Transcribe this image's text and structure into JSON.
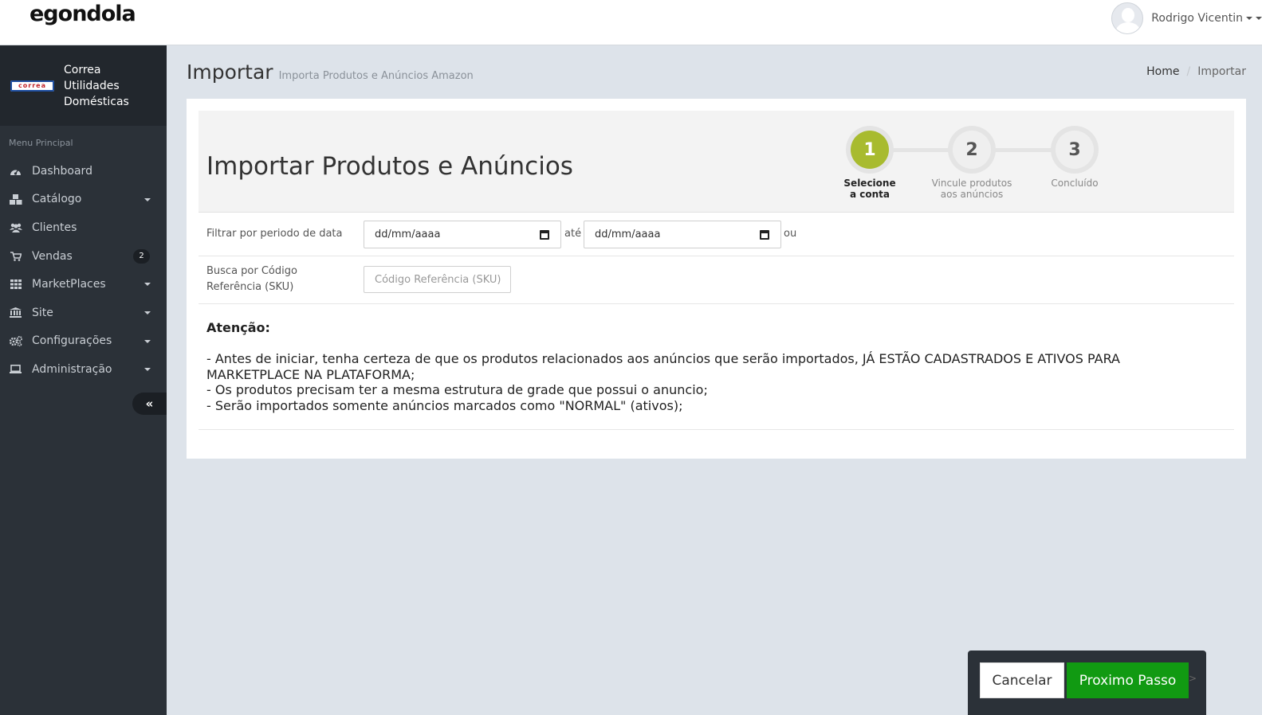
{
  "app": {
    "logo": "egondola"
  },
  "user": {
    "name": "Rodrigo Vicentin"
  },
  "store": {
    "logo_text": "correa",
    "name_line1": "Correa",
    "name_line2": "Utilidades",
    "name_line3": "Domésticas"
  },
  "sidebar": {
    "menu_title": "Menu Principal",
    "items": [
      {
        "label": "Dashboard",
        "icon": "dashboard-icon"
      },
      {
        "label": "Catálogo",
        "icon": "cubes-icon",
        "has_submenu": true
      },
      {
        "label": "Clientes",
        "icon": "users-icon"
      },
      {
        "label": "Vendas",
        "icon": "cart-icon",
        "badge": "2"
      },
      {
        "label": "MarketPlaces",
        "icon": "grid-icon",
        "has_submenu": true
      },
      {
        "label": "Site",
        "icon": "bank-icon",
        "has_submenu": true
      },
      {
        "label": "Configurações",
        "icon": "cogs-icon",
        "has_submenu": true
      },
      {
        "label": "Administração",
        "icon": "laptop-icon",
        "has_submenu": true
      }
    ],
    "collapse_symbol": "«"
  },
  "header": {
    "title": "Importar",
    "subtitle": "Importa Produtos e Anúncios Amazon"
  },
  "breadcrumb": {
    "home": "Home",
    "separator": "/",
    "current": "Importar"
  },
  "wizard": {
    "title": "Importar Produtos e Anúncios",
    "steps": [
      {
        "number": "1",
        "label_line1": "Selecione",
        "label_line2": "a conta",
        "active": true
      },
      {
        "number": "2",
        "label_line1": "Vincule produtos",
        "label_line2": "aos anúncios",
        "active": false
      },
      {
        "number": "3",
        "label_line1": "Concluído",
        "label_line2": "",
        "active": false
      }
    ],
    "accent_color": "#a8bb2f"
  },
  "filters": {
    "date_label": "Filtrar por periodo de data",
    "date_from_placeholder": "dd/mm/aaaa",
    "until": "até",
    "date_to_placeholder": "dd/mm/aaaa",
    "or": "ou",
    "sku_label_line1": "Busca por Código",
    "sku_label_line2": "Referência (SKU)",
    "sku_placeholder": "Código Referência (SKU)"
  },
  "notice": {
    "title": "Atenção:",
    "line1": "- Antes de iniciar, tenha certeza de que os produtos relacionados aos anúncios que serão importados, JÁ ESTÃO CADASTRADOS E ATIVOS PARA",
    "line2": "MARKETPLACE NA PLATAFORMA;",
    "line3": "- Os produtos precisam ter a mesma estrutura de grade que possui o anuncio;",
    "line4": "- Serão importados somente anúncios marcados como \"NORMAL\" (ativos);"
  },
  "actions": {
    "cancel_label": "Cancelar",
    "next_label": "Proximo Passo",
    "next_arrow": ">",
    "next_color": "#119a12"
  }
}
